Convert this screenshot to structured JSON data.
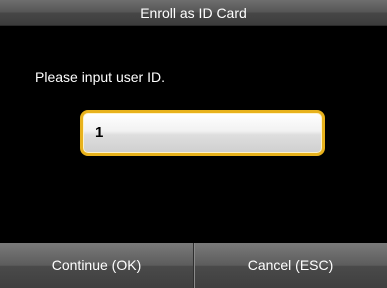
{
  "title_bar": {
    "title": "Enroll as ID Card"
  },
  "dialog": {
    "prompt": "Please input user ID.",
    "user_id_value": "1"
  },
  "buttons": {
    "continue_label": "Continue (OK)",
    "cancel_label": "Cancel (ESC)"
  },
  "colors": {
    "background": "#000000",
    "input_border_accent": "#e8b21c",
    "text": "#ffffff"
  }
}
